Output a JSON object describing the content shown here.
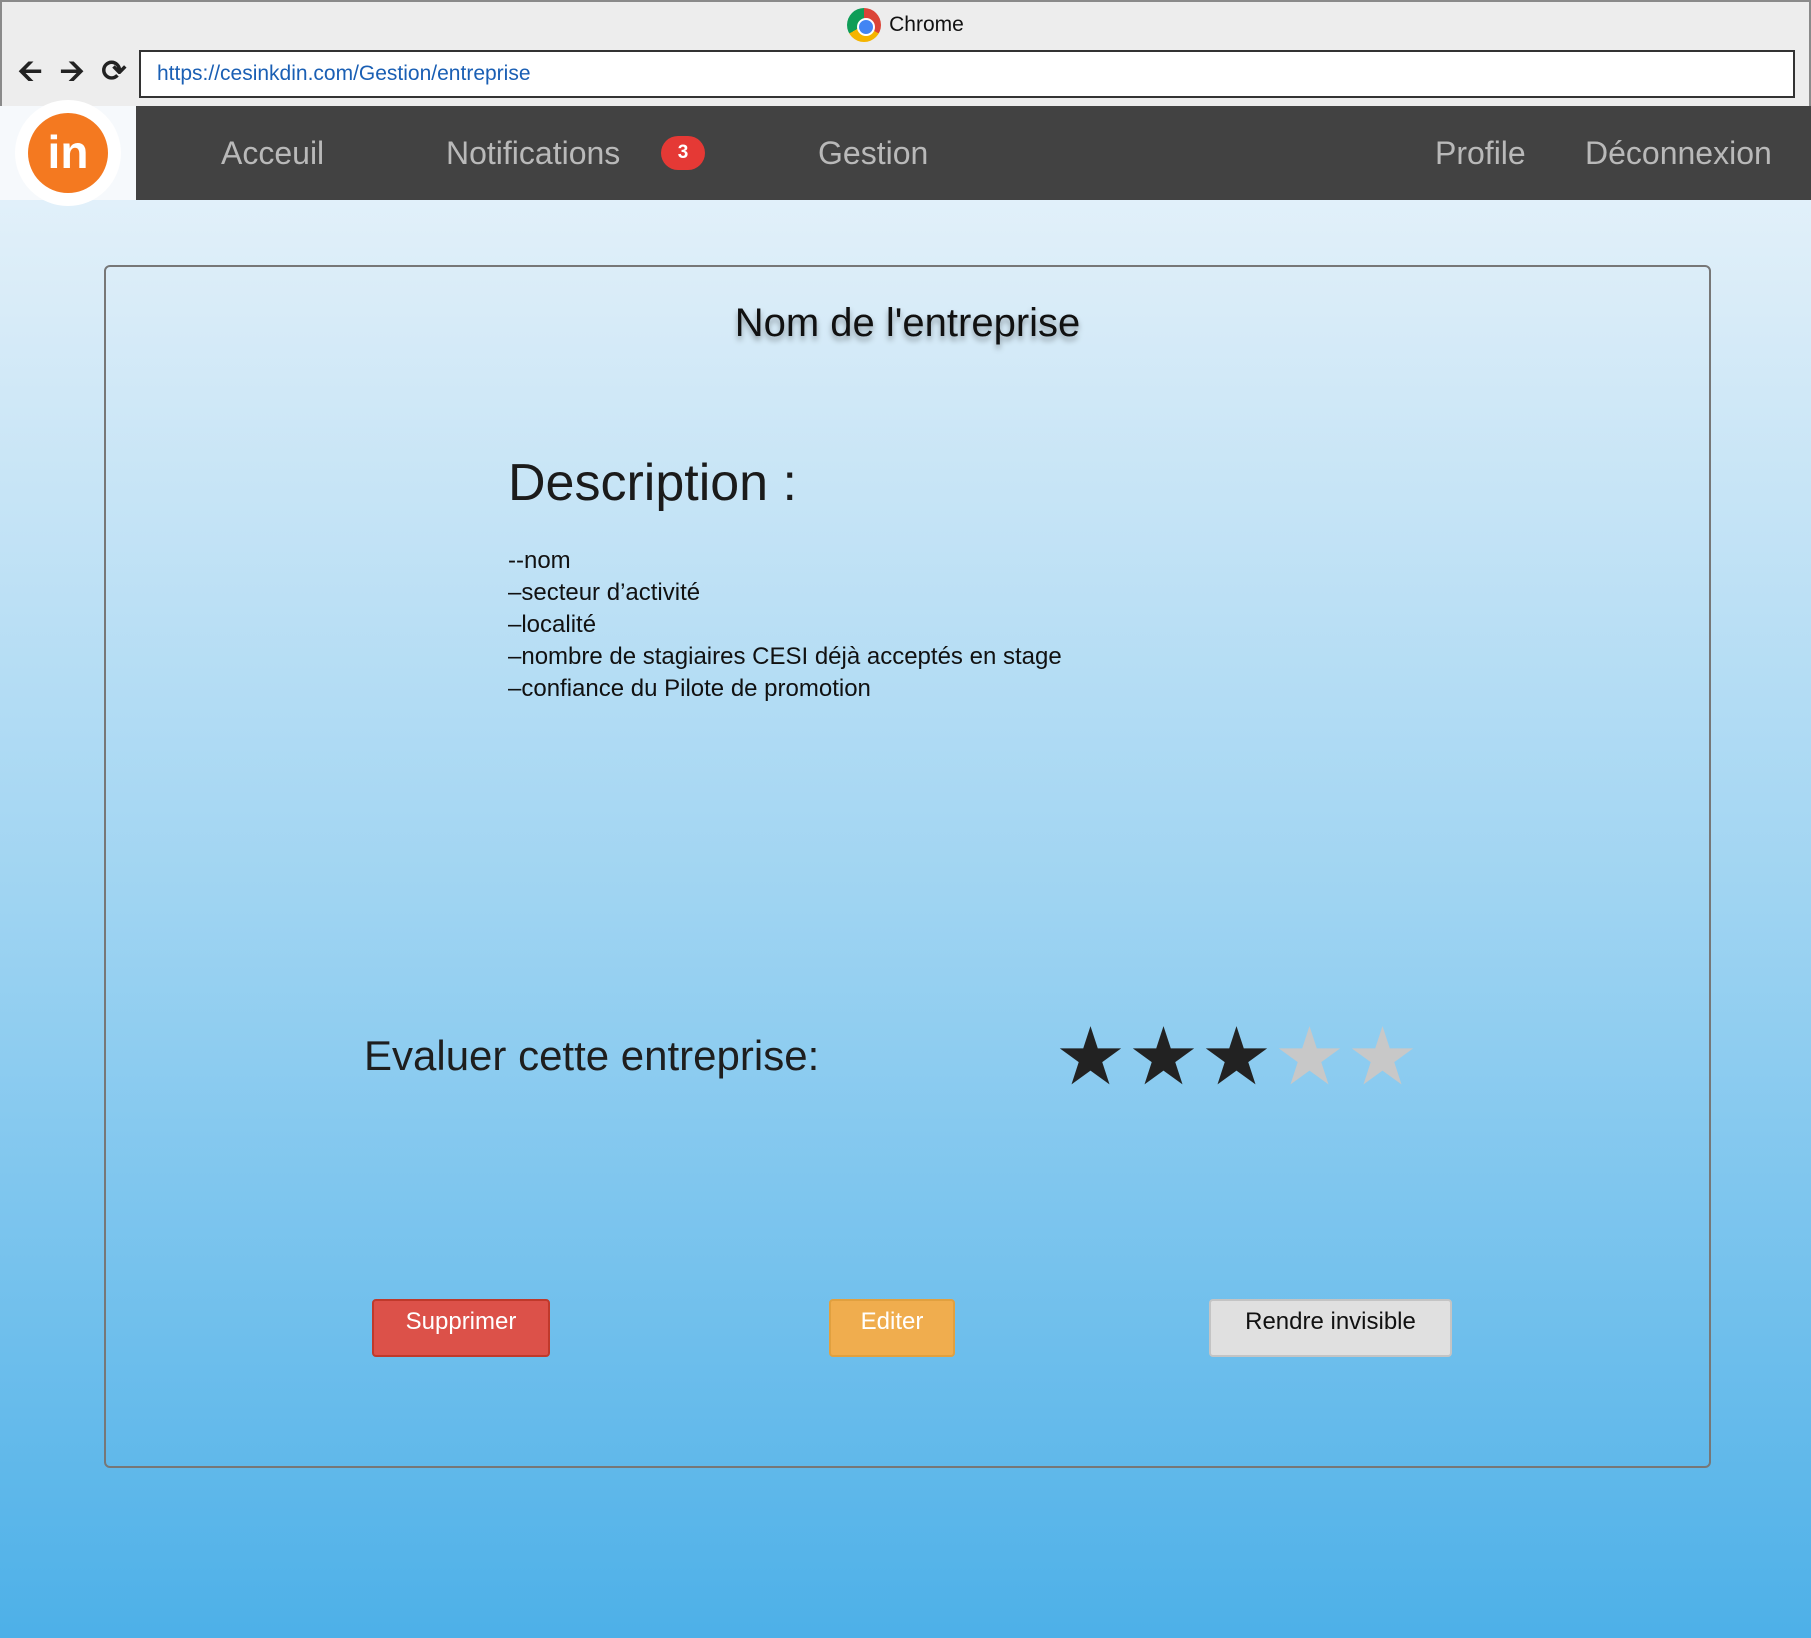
{
  "browser": {
    "title": "Chrome",
    "url": "https://cesinkdin.com/Gestion/entreprise",
    "back_icon": "arrow-left-icon",
    "forward_icon": "arrow-right-icon",
    "reload_icon": "reload-icon"
  },
  "app": {
    "logo_text": "in",
    "brand_color": "#f47920",
    "nav": {
      "home": "Acceuil",
      "notifications": "Notifications",
      "notifications_count": "3",
      "management": "Gestion",
      "profile": "Profile",
      "logout": "Déconnexion"
    }
  },
  "company": {
    "name": "Nom de l'entreprise",
    "description_title": "Description :",
    "description_items": [
      "--nom",
      "–secteur d’activité",
      "–localité",
      "–nombre  de  stagiaires  CESI  déjà acceptés en stage",
      "–confiance du Pilote de promotion"
    ],
    "rating_label": "Evaluer cette entreprise:",
    "rating": 3,
    "rating_max": 5
  },
  "actions": {
    "delete": "Supprimer",
    "edit": "Editer",
    "hide": "Rendre invisible"
  }
}
